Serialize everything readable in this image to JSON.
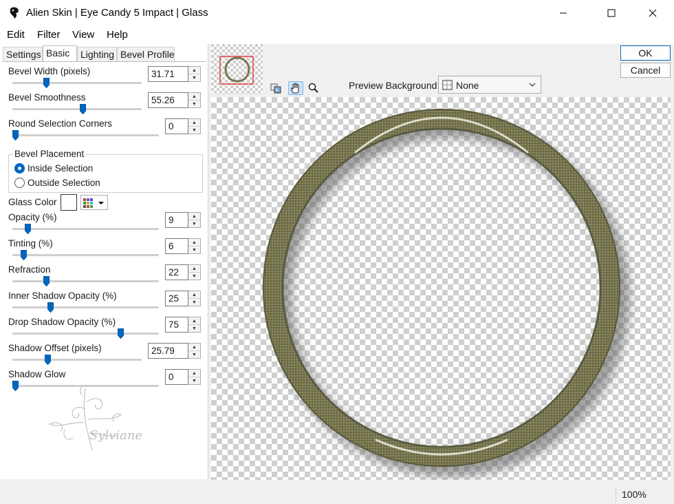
{
  "window": {
    "title": "Alien Skin | Eye Candy 5 Impact | Glass"
  },
  "menu": [
    "Edit",
    "Filter",
    "View",
    "Help"
  ],
  "tabs": [
    "Settings",
    "Basic",
    "Lighting",
    "Bevel Profile"
  ],
  "active_tab": "Basic",
  "controls": {
    "bevel_width": {
      "label": "Bevel Width (pixels)",
      "value": "31.71",
      "slider": 0.25
    },
    "bevel_smoothness": {
      "label": "Bevel Smoothness",
      "value": "55.26",
      "slider": 0.55
    },
    "round_corners": {
      "label": "Round Selection Corners",
      "value": "0",
      "slider": 0.0
    },
    "opacity": {
      "label": "Opacity (%)",
      "value": "9",
      "slider": 0.09
    },
    "tinting": {
      "label": "Tinting (%)",
      "value": "6",
      "slider": 0.06
    },
    "refraction": {
      "label": "Refraction",
      "value": "22",
      "slider": 0.22
    },
    "inner_shadow": {
      "label": "Inner Shadow Opacity (%)",
      "value": "25",
      "slider": 0.25
    },
    "drop_shadow": {
      "label": "Drop Shadow Opacity (%)",
      "value": "75",
      "slider": 0.75
    },
    "shadow_offset": {
      "label": "Shadow Offset (pixels)",
      "value": "25.79",
      "slider": 0.26
    },
    "shadow_glow": {
      "label": "Shadow Glow",
      "value": "0",
      "slider": 0.0
    }
  },
  "bevel_placement": {
    "legend": "Bevel Placement",
    "options": [
      "Inside Selection",
      "Outside Selection"
    ],
    "selected": "Inside Selection"
  },
  "glass_color": {
    "label": "Glass Color",
    "color": "#ffffff"
  },
  "watermark_text": "Sylviane",
  "preview_background": {
    "label": "Preview Background:",
    "value": "None"
  },
  "buttons": {
    "ok": "OK",
    "cancel": "Cancel"
  },
  "status": {
    "zoom": "100%"
  },
  "colors": {
    "accent": "#0067c0",
    "ring": "#77764f",
    "ring_dark": "#5a5a3c",
    "ring_highlight": "#e8e8d8"
  }
}
